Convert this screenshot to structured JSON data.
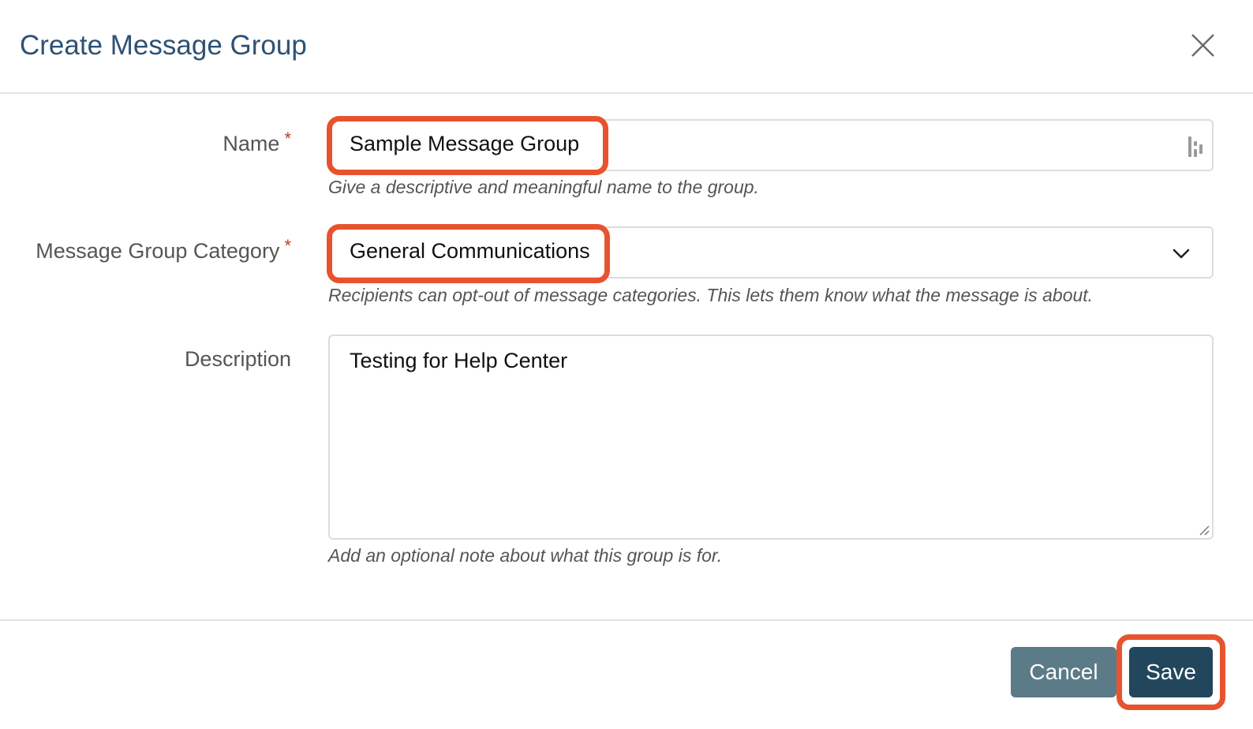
{
  "dialog": {
    "title": "Create Message Group",
    "close_icon": "close-icon"
  },
  "form": {
    "name": {
      "label": "Name",
      "required_mark": "*",
      "value": "Sample Message Group",
      "help": "Give a descriptive and meaningful name to the group.",
      "trailing_icon": "password-manager-icon"
    },
    "category": {
      "label": "Message Group Category",
      "required_mark": "*",
      "selected": "General Communications",
      "help": "Recipients can opt-out of message categories. This lets them know what the message is about.",
      "dropdown_icon": "chevron-down-icon"
    },
    "description": {
      "label": "Description",
      "value": "Testing for Help Center",
      "help": "Add an optional note about what this group is for.",
      "resize_icon": "resize-handle-icon"
    }
  },
  "footer": {
    "cancel_label": "Cancel",
    "save_label": "Save"
  },
  "colors": {
    "title": "#2d5274",
    "required": "#c0392b",
    "callout": "#e8532f",
    "cancel_button": "#5c7b88",
    "save_button": "#22475c"
  }
}
